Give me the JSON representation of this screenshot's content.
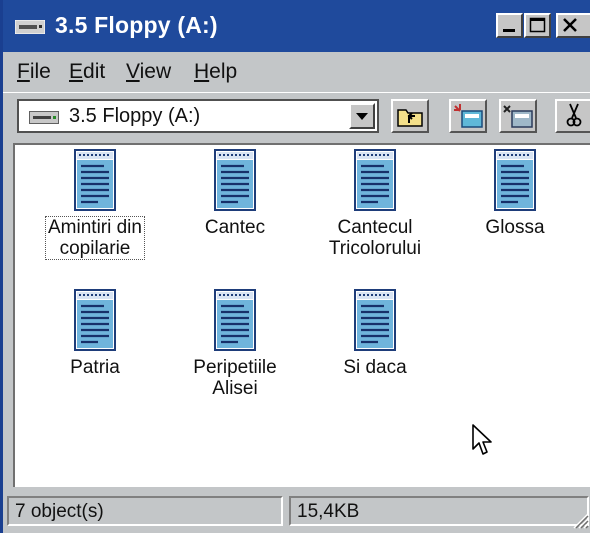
{
  "window": {
    "title": "3.5 Floppy (A:)",
    "controls": [
      "minimize-icon",
      "maximize-icon",
      "close-icon"
    ],
    "colors": {
      "titlebar": "#1f4a9c",
      "chrome": "#c3c6c8",
      "content": "#ffffff"
    }
  },
  "menu": [
    {
      "accel": "F",
      "rest": "ile"
    },
    {
      "accel": "E",
      "rest": "dit"
    },
    {
      "accel": "V",
      "rest": "iew"
    },
    {
      "accel": "H",
      "rest": "elp"
    }
  ],
  "address": {
    "value": "3.5 Floppy (A:)",
    "icon": "floppy-drive-icon"
  },
  "toolbar": [
    "up-folder-icon",
    "map-drive-icon",
    "disconnect-drive-icon",
    "cut-icon"
  ],
  "files": [
    {
      "line1": "Amintiri din",
      "line2": "copilarie",
      "icon": "text-document-icon"
    },
    {
      "line1": "Cantec",
      "line2": "",
      "icon": "text-document-icon"
    },
    {
      "line1": "Cantecul",
      "line2": "Tricolorului",
      "icon": "text-document-icon"
    },
    {
      "line1": "Glossa",
      "line2": "",
      "icon": "text-document-icon"
    },
    {
      "line1": "Patria",
      "line2": "",
      "icon": "text-document-icon"
    },
    {
      "line1": "Peripetiile",
      "line2": "Alisei",
      "icon": "text-document-icon"
    },
    {
      "line1": "Si daca",
      "line2": "",
      "icon": "text-document-icon"
    }
  ],
  "status": {
    "objects": "7 object(s)",
    "size": "15,4KB"
  }
}
